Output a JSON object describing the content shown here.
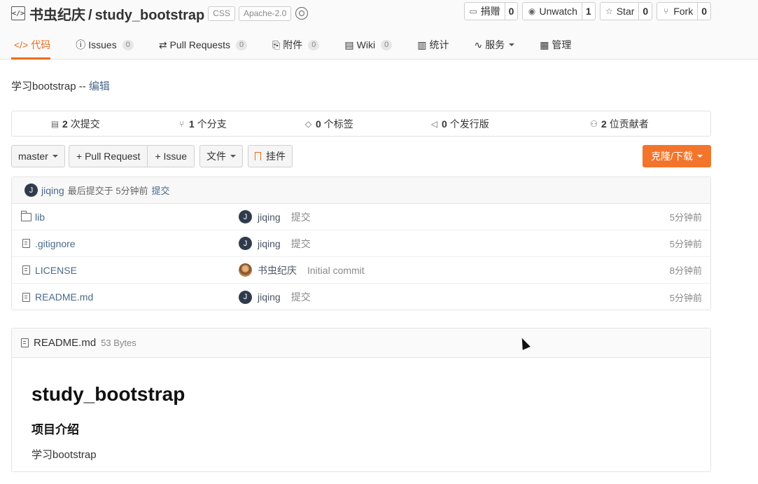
{
  "repo": {
    "owner": "书虫纪庆",
    "slash": "/",
    "name": "study_bootstrap",
    "lang_tag": "CSS",
    "license_tag": "Apache-2.0"
  },
  "actions": [
    {
      "label": "捐赠",
      "count": "0",
      "icon": "donate-icon",
      "glyph": "▭"
    },
    {
      "label": "Unwatch",
      "count": "1",
      "icon": "eye-icon",
      "glyph": "◉"
    },
    {
      "label": "Star",
      "count": "0",
      "icon": "star-icon",
      "glyph": "☆"
    },
    {
      "label": "Fork",
      "count": "0",
      "icon": "fork-icon",
      "glyph": "⑂"
    }
  ],
  "tabs": [
    {
      "label": "代码",
      "glyph": "</>",
      "badge": null
    },
    {
      "label": "Issues",
      "glyph": "ⓘ",
      "badge": "0"
    },
    {
      "label": "Pull Requests",
      "glyph": "⇄",
      "badge": "0"
    },
    {
      "label": "附件",
      "glyph": "⎘",
      "badge": "0"
    },
    {
      "label": "Wiki",
      "glyph": "▤",
      "badge": "0"
    },
    {
      "label": "统计",
      "glyph": "▥",
      "badge": null
    },
    {
      "label": "服务",
      "glyph": "∿",
      "badge": null
    },
    {
      "label": "管理",
      "glyph": "▦",
      "badge": null
    }
  ],
  "description": {
    "text": "学习bootstrap -- ",
    "edit_link": "编辑"
  },
  "stats": [
    {
      "num": "2",
      "label": "次提交",
      "glyph": "▤"
    },
    {
      "num": "1",
      "label": "个分支",
      "glyph": "⑂"
    },
    {
      "num": "0",
      "label": "个标签",
      "glyph": "◇"
    },
    {
      "num": "0",
      "label": "个发行版",
      "glyph": "◁"
    },
    {
      "num": "2",
      "label": "位贡献者",
      "glyph": "⚇"
    }
  ],
  "toolbar": {
    "branch": "master",
    "pull_request": "+ Pull Request",
    "issue": "+ Issue",
    "file_menu": "文件",
    "widget": "挂件",
    "clone": "克隆/下载"
  },
  "last_commit": {
    "avatar": "J",
    "author": "jiqing",
    "text": "最后提交于 5分钟前",
    "link": "提交"
  },
  "files": [
    {
      "type": "folder",
      "name": "lib",
      "avatar": "J",
      "author": "jiqing",
      "message": "提交",
      "time": "5分钟前"
    },
    {
      "type": "file",
      "name": ".gitignore",
      "avatar": "J",
      "author": "jiqing",
      "message": "提交",
      "time": "5分钟前"
    },
    {
      "type": "file",
      "name": "LICENSE",
      "avatar": "",
      "author": "书虫纪庆",
      "message": "Initial commit",
      "time": "8分钟前"
    },
    {
      "type": "file",
      "name": "README.md",
      "avatar": "J",
      "author": "jiqing",
      "message": "提交",
      "time": "5分钟前"
    }
  ],
  "readme": {
    "filename": "README.md",
    "size": "53 Bytes",
    "h1": "study_bootstrap",
    "h3": "项目介绍",
    "body": "学习bootstrap"
  },
  "colors": {
    "accent": "#e96d1f",
    "clone_button": "#f3752b",
    "link": "#4a6a8a"
  }
}
